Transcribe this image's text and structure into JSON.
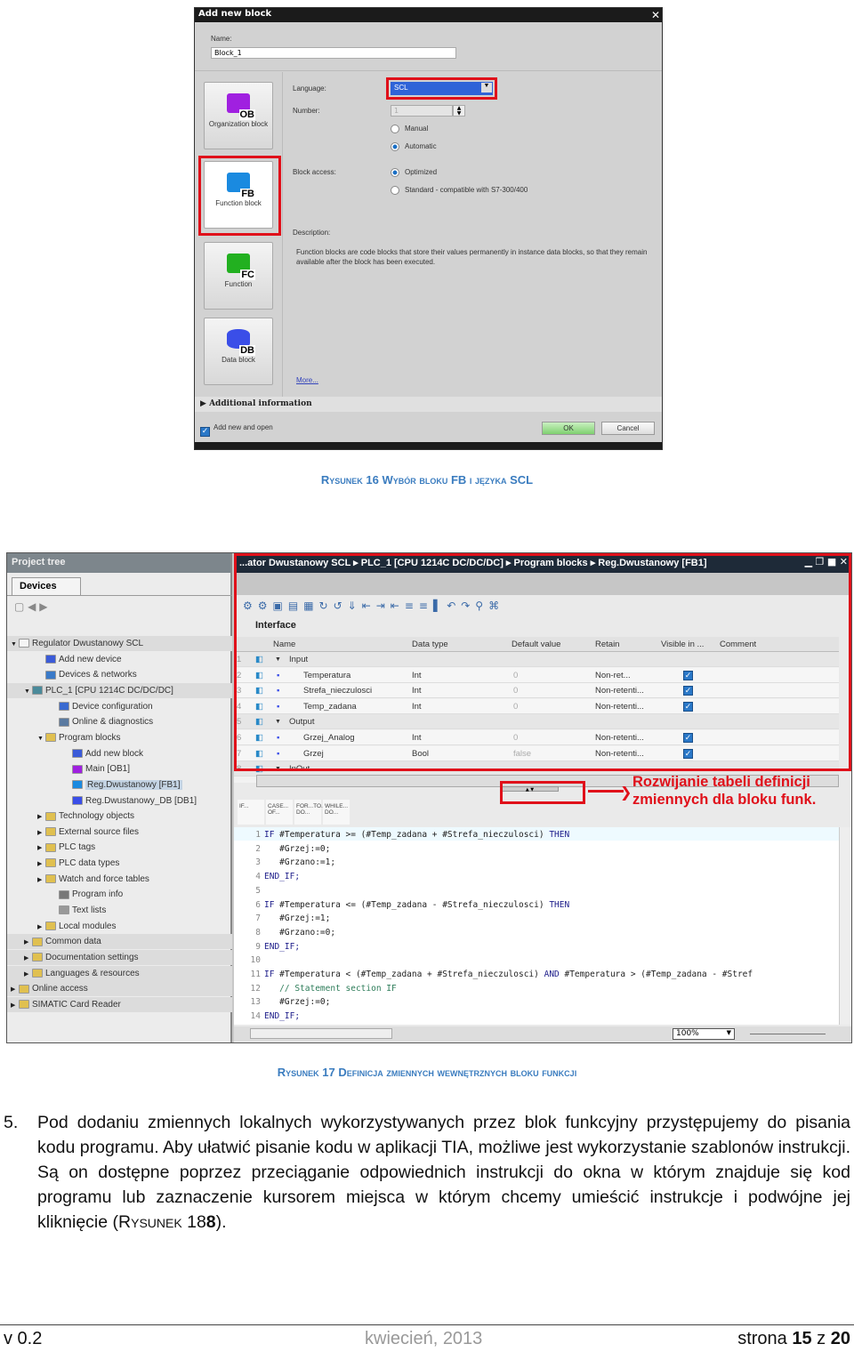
{
  "dialog": {
    "title": "Add new block",
    "name_label": "Name:",
    "name_value": "Block_1",
    "tiles": [
      {
        "label": "Organization block",
        "badge": "OB",
        "color": "#a020e0"
      },
      {
        "label": "Function block",
        "badge": "FB",
        "color": "#1a8ae0"
      },
      {
        "label": "Function",
        "badge": "FC",
        "color": "#22b020"
      },
      {
        "label": "Data block",
        "badge": "DB",
        "color": "#3a4ee8"
      }
    ],
    "language_label": "Language:",
    "language_value": "SCL",
    "number_label": "Number:",
    "number_value": "1",
    "number_modes": [
      {
        "label": "Manual",
        "selected": false
      },
      {
        "label": "Automatic",
        "selected": true
      }
    ],
    "block_access_label": "Block access:",
    "block_access": [
      {
        "label": "Optimized",
        "selected": true
      },
      {
        "label": "Standard - compatible with S7-300/400",
        "selected": false
      }
    ],
    "description_label": "Description:",
    "description": "Function blocks are code blocks that store their values permanently in instance data blocks, so that they remain available after the block has been executed.",
    "more_link": "More...",
    "additional_info": "Additional  information",
    "add_and_open_label": "Add new and open",
    "add_and_open_checked": true,
    "ok": "OK",
    "cancel": "Cancel"
  },
  "caption1": "Rysunek 16  Wybór bloku FB i języka SCL",
  "project_tree": {
    "title": "Project tree",
    "tab": "Devices",
    "items": [
      {
        "label": "Regulator Dwustanowy SCL",
        "level": 0,
        "tw": "▼",
        "icon": "#f4f4f4"
      },
      {
        "label": "Add new device",
        "level": 2,
        "tw": "",
        "icon": "#3b5bd8"
      },
      {
        "label": "Devices & networks",
        "level": 2,
        "tw": "",
        "icon": "#3a7ac8"
      },
      {
        "label": "PLC_1 [CPU 1214C DC/DC/DC]",
        "level": 1,
        "tw": "▼",
        "icon": "#4a8a9a"
      },
      {
        "label": "Device configuration",
        "level": 3,
        "tw": "",
        "icon": "#3a6ad0"
      },
      {
        "label": "Online & diagnostics",
        "level": 3,
        "tw": "",
        "icon": "#5a7aa0"
      },
      {
        "label": "Program blocks",
        "level": 2,
        "tw": "▼",
        "icon": "#e0c050"
      },
      {
        "label": "Add new block",
        "level": 4,
        "tw": "",
        "icon": "#3b5bd8"
      },
      {
        "label": "Main [OB1]",
        "level": 4,
        "tw": "",
        "icon": "#a020e0"
      },
      {
        "label": "Reg.Dwustanowy [FB1]",
        "level": 4,
        "tw": "",
        "icon": "#1a8ae0",
        "selected": true
      },
      {
        "label": "Reg.Dwustanowy_DB [DB1]",
        "level": 4,
        "tw": "",
        "icon": "#3a4ee8"
      },
      {
        "label": "Technology objects",
        "level": 2,
        "tw": "▶",
        "icon": "#e0c050"
      },
      {
        "label": "External source files",
        "level": 2,
        "tw": "▶",
        "icon": "#e0c050"
      },
      {
        "label": "PLC tags",
        "level": 2,
        "tw": "▶",
        "icon": "#e0c050"
      },
      {
        "label": "PLC data types",
        "level": 2,
        "tw": "▶",
        "icon": "#e0c050"
      },
      {
        "label": "Watch and force tables",
        "level": 2,
        "tw": "▶",
        "icon": "#e0c050"
      },
      {
        "label": "Program info",
        "level": 3,
        "tw": "",
        "icon": "#777"
      },
      {
        "label": "Text lists",
        "level": 3,
        "tw": "",
        "icon": "#999"
      },
      {
        "label": "Local modules",
        "level": 2,
        "tw": "▶",
        "icon": "#e0c050"
      },
      {
        "label": "Common data",
        "level": 1,
        "tw": "▶",
        "icon": "#e0c050"
      },
      {
        "label": "Documentation settings",
        "level": 1,
        "tw": "▶",
        "icon": "#e0c050"
      },
      {
        "label": "Languages & resources",
        "level": 1,
        "tw": "▶",
        "icon": "#e0c050"
      },
      {
        "label": "Online access",
        "level": 0,
        "tw": "▶",
        "icon": "#e0c050"
      },
      {
        "label": "SIMATIC Card Reader",
        "level": 0,
        "tw": "▶",
        "icon": "#e0c050"
      }
    ]
  },
  "editor": {
    "breadcrumb": "...ator Dwustanowy SCL  ▸  PLC_1 [CPU 1214C DC/DC/DC]  ▸  Program blocks  ▸  Reg.Dwustanowy [FB1]",
    "interface_title": "Interface",
    "columns": [
      "Name",
      "Data type",
      "Default value",
      "Retain",
      "Visible in ...",
      "Comment"
    ],
    "rows": [
      {
        "n": "1",
        "name": "Input",
        "section": true,
        "type": "",
        "default": "",
        "retain": "",
        "visible": false
      },
      {
        "n": "2",
        "name": "Temperatura",
        "section": false,
        "type": "Int",
        "default": "0",
        "retain": "Non-ret...",
        "visible": true
      },
      {
        "n": "3",
        "name": "Strefa_nieczulosci",
        "section": false,
        "type": "Int",
        "default": "0",
        "retain": "Non-retenti...",
        "visible": true
      },
      {
        "n": "4",
        "name": "Temp_zadana",
        "section": false,
        "type": "Int",
        "default": "0",
        "retain": "Non-retenti...",
        "visible": true
      },
      {
        "n": "5",
        "name": "Output",
        "section": true,
        "type": "",
        "default": "",
        "retain": "",
        "visible": false
      },
      {
        "n": "6",
        "name": "Grzej_Analog",
        "section": false,
        "type": "Int",
        "default": "0",
        "retain": "Non-retenti...",
        "visible": true
      },
      {
        "n": "7",
        "name": "Grzej",
        "section": false,
        "type": "Bool",
        "default": "false",
        "retain": "Non-retenti...",
        "visible": true
      },
      {
        "n": "8",
        "name": "InOut",
        "section": true,
        "type": "",
        "default": "",
        "retain": "",
        "visible": false
      }
    ],
    "instruction_templates": [
      "IF...",
      "CASE... OF...",
      "FOR...TO... DO...",
      "WHILE... DO..."
    ],
    "annotation": "Rozwijanie tabeli definicji zmiennych dla bloku funk.",
    "code": [
      "IF #Temperatura >= (#Temp_zadana + #Strefa_nieczulosci) THEN",
      "   #Grzej:=0;",
      "   #Grzano:=1;",
      "END_IF;",
      "",
      "IF #Temperatura <= (#Temp_zadana - #Strefa_nieczulosci) THEN",
      "   #Grzej:=1;",
      "   #Grzano:=0;",
      "END_IF;",
      "",
      "IF #Temperatura < (#Temp_zadana + #Strefa_nieczulosci) AND #Temperatura > (#Temp_zadana - #Stref",
      "   // Statement section IF",
      "   #Grzej:=0;",
      "END_IF;"
    ],
    "zoom": "100%"
  },
  "caption2": "Rysunek 17 Definicja zmiennych wewnętrznych bloku funkcji",
  "paragraph": {
    "number": "5.",
    "text": "Pod dodaniu zmiennych lokalnych wykorzystywanych przez blok funkcyjny przystępujemy do pisania kodu programu. Aby ułatwić pisanie kodu w aplikacji TIA, możliwe jest wykorzystanie szablonów instrukcji. Są on dostępne poprzez przeciąganie odpowiednich instrukcji do okna w którym znajduje się kod programu lub zaznaczenie kursorem miejsca w którym chcemy umieścić instrukcje i podwójne jej kliknięcie (",
    "ref_prefix": "Rysunek 18",
    "ref_suffix": "8",
    "end": ")."
  },
  "footer": {
    "version": "v 0.2",
    "date": "kwiecień, 2013",
    "page_prefix": "strona ",
    "page": "15",
    "page_mid": " z ",
    "total": "20"
  },
  "colors": {
    "highlight": "#e0101a",
    "caption": "#3a7cbf"
  }
}
